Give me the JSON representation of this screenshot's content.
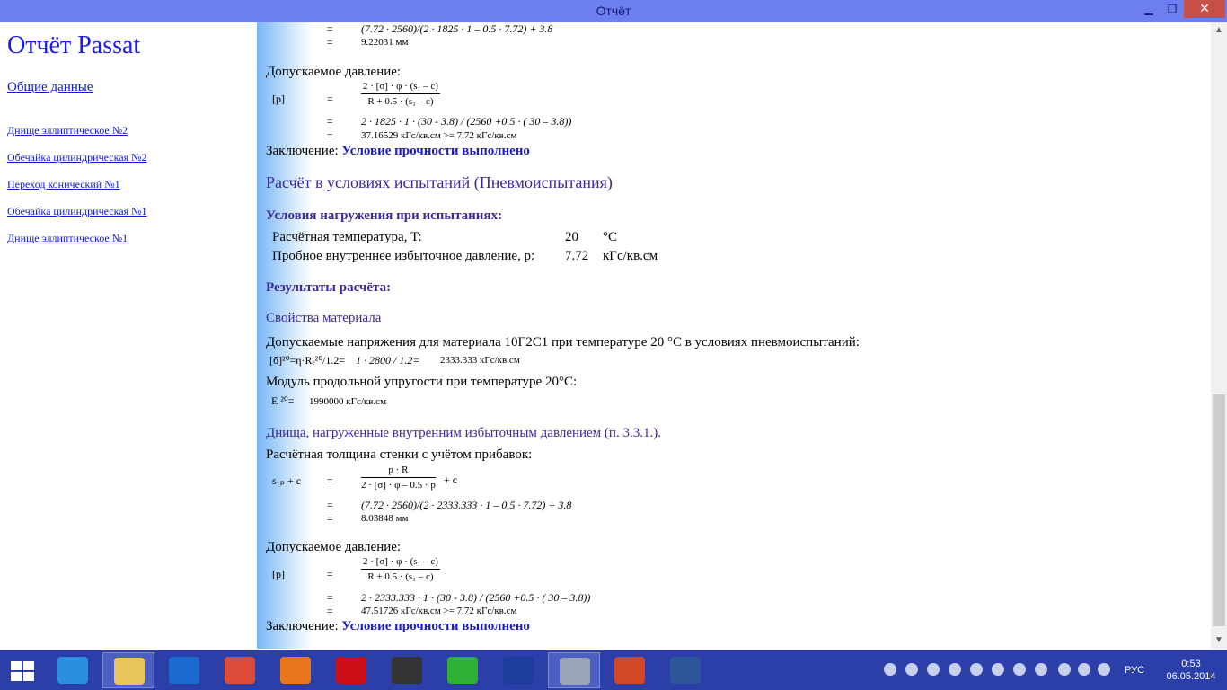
{
  "window": {
    "title": "Отчёт",
    "min_glyph": "▁",
    "max_glyph": "❐",
    "close_glyph": "✕"
  },
  "sidebar": {
    "title": "Отчёт Passat",
    "main_link": "Общие данные",
    "links": [
      "Днище эллиптическое №2",
      "Обечайка цилиндрическая №2",
      "Переход конический №1",
      "Обечайка цилиндрическая №1",
      "Днище эллиптическое №1"
    ]
  },
  "content": {
    "top": {
      "eq_sign": "=",
      "line1": "(7.72 · 2560)/(2 · 1825 · 1 – 0.5 · 7.72) + 3.8",
      "line2": "9.22031 мм"
    },
    "block1": {
      "heading": "Допускаемое давление:",
      "lhs": "[p]",
      "num": "2 · [σ] · φ · (s₁ – c)",
      "den": "R + 0.5 · (s₁ – c)",
      "line1": "2 · 1825 · 1 · (30 - 3.8) / (2560 +0.5 · ( 30 – 3.8))",
      "line2": "37.16529 кГс/кв.см >= 7.72 кГс/кв.см",
      "concl_label": "Заключение:",
      "concl_value": "Условие прочности выполнено"
    },
    "section_title": "Расчёт в условиях испытаний (Пневмоиспытания)",
    "loads": {
      "title": "Условия нагружения при  испытаниях:",
      "rows": [
        {
          "label": "Расчётная температура, T:",
          "value": "20",
          "unit": "°C"
        },
        {
          "label": "Пробное внутреннее избыточное давление, p:",
          "value": "7.72",
          "unit": "кГс/кв.см"
        }
      ]
    },
    "results_title": "Результаты расчёта:",
    "material": {
      "title": "Свойства материала",
      "text1": "Допускаемые напряжения для материала 10Г2С1 при температуре 20 °С в условиях пневмоиспытаний:",
      "formula1": "[б]²⁰=η·Rₑ²⁰/1.2=",
      "formula1_calc": "1 · 2800 / 1.2=",
      "formula1_value": "2333.333 кГс/кв.см",
      "text2": "Модуль продольной упругости при температуре 20°С:",
      "formula2": "E ²⁰=",
      "formula2_value": "1990000 кГс/кв.см"
    },
    "heads": {
      "title": "Днища, нагруженные внутренним избыточным давлением (п. 3.3.1.).",
      "text": "Расчётная толщина стенки с учётом прибавок:",
      "lhs": "s₁ₚ + c",
      "num": "p · R",
      "den": "2 · [σ] · φ – 0.5 · p",
      "plus": "+ c",
      "line1": "(7.72 · 2560)/(2 · 2333.333 · 1 – 0.5 · 7.72) + 3.8",
      "line2": "8.03848 мм"
    },
    "block2": {
      "heading": "Допускаемое давление:",
      "lhs": "[p]",
      "num": "2 · [σ] · φ · (s₁ – c)",
      "den": "R + 0.5 · (s₁ – c)",
      "line1": "2 · 2333.333 · 1 · (30 - 3.8) / (2560 +0.5 · ( 30 – 3.8))",
      "line2": "47.51726 кГс/кв.см >= 7.72 кГс/кв.см",
      "concl_label": "Заключение:",
      "concl_value": "Условие прочности выполнено"
    }
  },
  "scrollbar": {
    "up": "▲",
    "down": "▼"
  },
  "taskbar": {
    "apps": [
      {
        "name": "ie-icon",
        "color": "#2a8fe0"
      },
      {
        "name": "file-explorer-icon",
        "color": "#e9c45a"
      },
      {
        "name": "hp-icon",
        "color": "#1a6ad0"
      },
      {
        "name": "chrome-icon",
        "color": "#dd4b39"
      },
      {
        "name": "firefox-icon",
        "color": "#e8761a"
      },
      {
        "name": "opera-icon",
        "color": "#cc0f16"
      },
      {
        "name": "remote-app-icon",
        "color": "#333333"
      },
      {
        "name": "store-icon",
        "color": "#2db034"
      },
      {
        "name": "passat-icon",
        "color": "#1d3c9c"
      },
      {
        "name": "passat-report-icon",
        "color": "#9aa3b8"
      },
      {
        "name": "powerpoint-icon",
        "color": "#d24726"
      },
      {
        "name": "word-icon",
        "color": "#2b579a"
      }
    ],
    "lang": "РУС",
    "time": "0:53",
    "date": "06.05.2014"
  }
}
